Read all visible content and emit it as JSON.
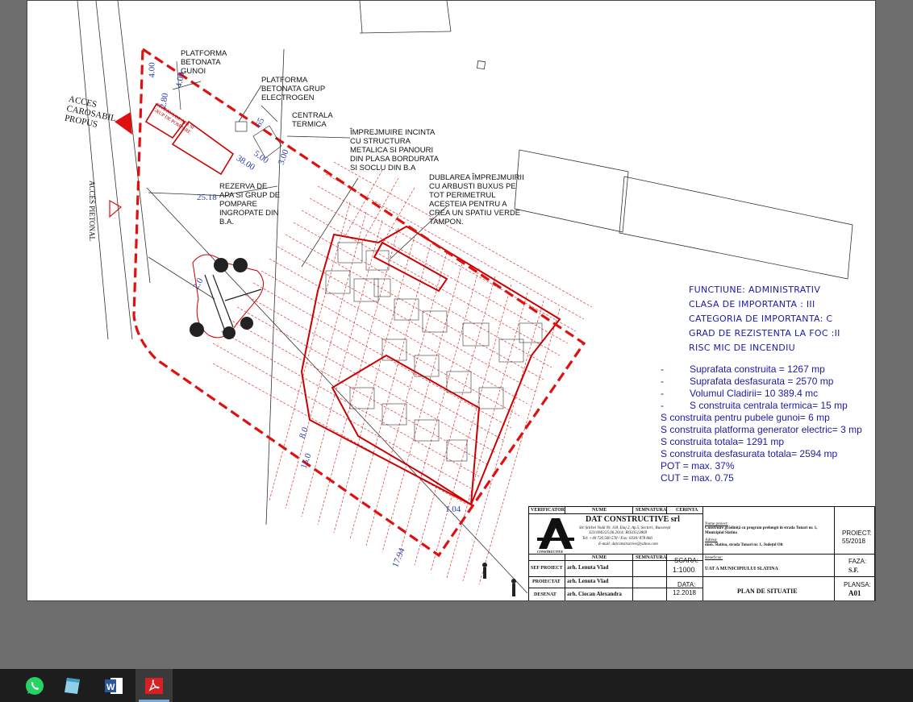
{
  "drawing": {
    "labels": {
      "platforma_gunoi": [
        "PLATFORMA",
        "BETONATA",
        "GUNOI"
      ],
      "platforma_grup": [
        "PLATFORMA",
        "BETONATA GRUP",
        "ELECTROGEN"
      ],
      "centrala": [
        "CENTRALA",
        "TERMICA"
      ],
      "imprejmuire": [
        "ÎMPREJMUIRE INCINTA",
        "CU STRUCTURA",
        "METALICA SI PANOURI",
        "DIN PLASA BORDURATA",
        "SI SOCLU DIN B.A"
      ],
      "dublarea": [
        "DUBLAREA ÎMPREJMUIRII",
        "CU ARBUSTI BUXUS PE",
        "TOT PERIMETRUL",
        "ACESTEIA PENTRU A",
        "CREA UN SPATIU VERDE",
        "TAMPON."
      ],
      "rezerva_apa": [
        "REZERVA DE",
        "APA SI GRUP DE",
        "POMPARE",
        "INGROPATE DIN",
        "B.A."
      ],
      "acces_carosabil": [
        "ACCES",
        "CAROSABIL",
        "PROPUS"
      ],
      "acces_pietonal": "ACCES PIETONAL",
      "rezerva_small": [
        "REZERVA DE APA SI",
        "GRUP DE POMPARE"
      ]
    },
    "dimensions": [
      "4.00",
      "4.00",
      "2.80",
      "65",
      "5.00",
      "3.00",
      "38.00",
      "25.18",
      "2.0",
      "8.0",
      "15.0",
      "17.94",
      "1.04"
    ]
  },
  "notes": {
    "functiune": "FUNCTIUNE: ADMINISTRATIV",
    "clasa": "CLASA DE IMPORTANTA : III",
    "categoria": "CATEGORIA  DE IMPORTANTA: C",
    "grad": "GRAD DE REZISTENTA LA FOC :II",
    "risc": "RISC MIC DE INCENDIU"
  },
  "stats": {
    "dash": "-",
    "s_construita": "Suprafata construita  =  1267 mp",
    "s_desfasurata": "Suprafata  desfasurata  = 2570 mp",
    "volum": "Volumul Cladirii= 10 389.4 mc",
    "centrala": "S construita centrala termica= 15 mp",
    "pubele": "S construita pentru pubele gunoi= 6 mp",
    "generator": "S construita platforma generator electric= 3 mp",
    "totala": "S construita totala= 1291 mp",
    "desf_totala": "S construita desfasurata totala= 2594 mp",
    "pot": "POT = max. 37%",
    "cut": "CUT = max. 0.75"
  },
  "title_block": {
    "verificator": "VERIFICATOR",
    "nume": "NUME",
    "semnatura": "SEMNATURA",
    "cerinta": "CERINTA",
    "company": "DAT CONSTRUCTIVE srl",
    "address": "Str. Știrbei Vodă Nr. 118, Etaj 2, Ap.5, Sector1, București",
    "reg": "J23/1845/25.06.2014; RO33513869",
    "tel": "Tel: +40 726 500 578 / Fax: 0330/ 878 866",
    "email": "E-mail: datconstructive@yahoo.com",
    "logo_text": "CONSTRUCTIVE",
    "nume_proiect_label": "Nume proiect:",
    "nume_proiect": "Construire grădiniță cu program prelungit in strada Tunari nr. 1, Municipiul Slatina",
    "adresa_label": "Adresa:",
    "adresa": "mun. Slatina, strada Tunari nr. 1, Județul Olt",
    "proiect_label": "PROIECT:",
    "proiect_nr": "55/2018",
    "nume2": "NUME",
    "semnatura2": "SEMNATURA",
    "sef_proiect_label": "SEF PROIECT",
    "sef_proiect": "arh. Lenuta Vlad",
    "proiectat_label": "PROIECTAT",
    "proiectat": "arh. Lenuta Vlad",
    "desenat_label": "DESENAT",
    "desenat": "arh. Ciocan Alexandra",
    "scara_label": "SCARA:",
    "scara": "1:1000",
    "data_label": "DATA:",
    "data": "12.2018",
    "beneficiar_label": "Beneficiar:",
    "beneficiar": "UAT  A MUNICIPIULUI SLATINA",
    "faza_label": "FAZA:",
    "faza": "S.F.",
    "plan": "PLAN DE SITUATIE",
    "plansa_label": "PLANSA:",
    "plansa": "A01"
  },
  "taskbar": {
    "icons": [
      "partial-app-icon",
      "whatsapp-icon",
      "notepad-icon",
      "word-icon",
      "pdf-icon"
    ],
    "colors": {
      "whatsapp": "#25d366",
      "word": "#2b579a",
      "pdf": "#d81f26"
    }
  }
}
